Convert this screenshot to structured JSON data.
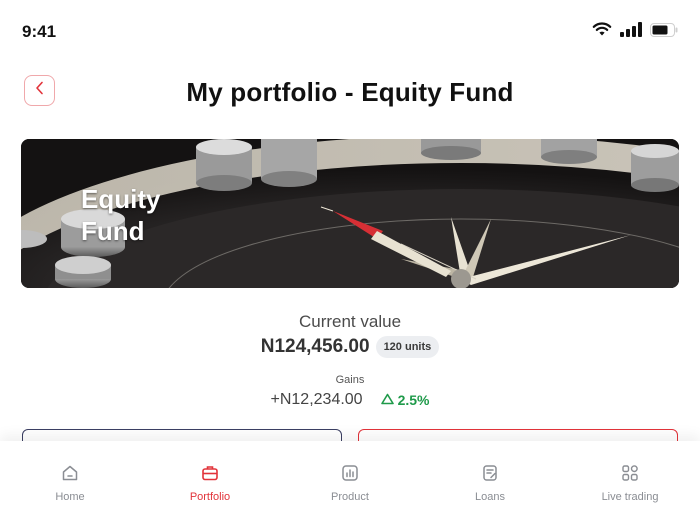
{
  "status_bar": {
    "time": "9:41",
    "icons": [
      "wifi-icon",
      "signal-icon",
      "battery-icon"
    ]
  },
  "header": {
    "title": "My portfolio - Equity Fund",
    "back_icon": "chevron-left-icon"
  },
  "banner": {
    "title": "Equity Fund"
  },
  "summary": {
    "current_value_label": "Current value",
    "current_value": "N124,456.00",
    "units": "120 units",
    "gains_label": "Gains",
    "gains_value": "+N12,234.00",
    "gains_percent": "2.5%",
    "gains_icon": "triangle-up-icon"
  },
  "nav": {
    "items": [
      {
        "label": "Home",
        "icon": "home-icon"
      },
      {
        "label": "Portfolio",
        "icon": "briefcase-icon",
        "active": true
      },
      {
        "label": "Product",
        "icon": "chart-icon"
      },
      {
        "label": "Loans",
        "icon": "document-icon"
      },
      {
        "label": "Live trading",
        "icon": "apps-icon"
      }
    ]
  },
  "colors": {
    "accent": "#e2333a",
    "gain": "#1f9a4a",
    "navy": "#3b3f63",
    "muted": "#8a8d93"
  }
}
